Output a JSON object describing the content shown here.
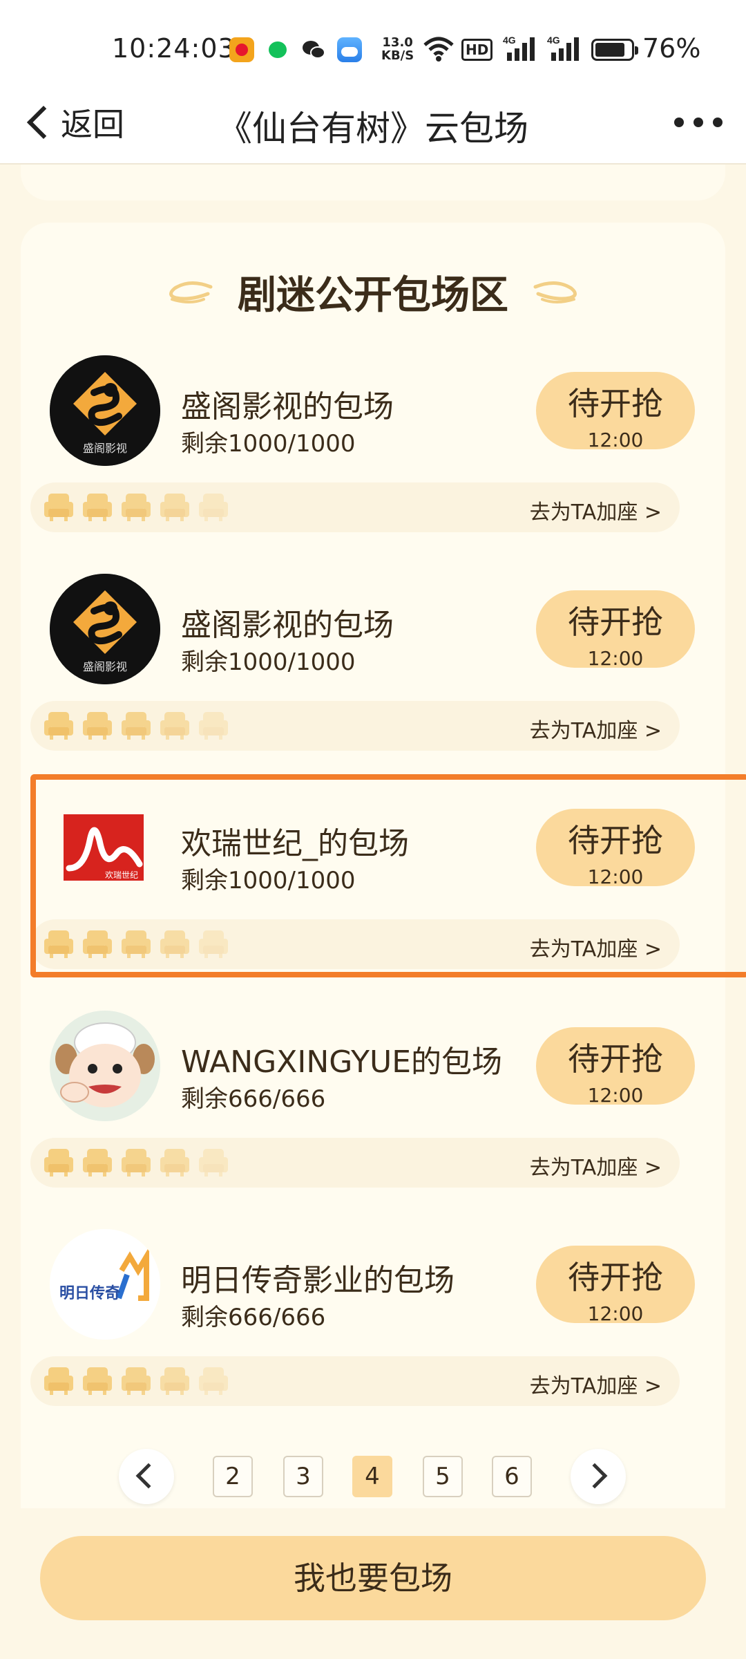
{
  "status_bar": {
    "time": "10:24:03",
    "net_speed_value": "13.0",
    "net_speed_unit": "KB/S",
    "hd_label": "HD",
    "network_1": "4G",
    "network_2": "4G",
    "battery": "76%"
  },
  "nav": {
    "back_label": "返回",
    "title": "《仙台有树》云包场"
  },
  "section": {
    "title": "剧迷公开包场区"
  },
  "items": [
    {
      "name": "盛阁影视的包场",
      "remain": "剩余1000/1000",
      "button": "待开抢",
      "time": "12:00",
      "link": "去为TA加座 >",
      "avatar_text": "盛阁影视"
    },
    {
      "name": "盛阁影视的包场",
      "remain": "剩余1000/1000",
      "button": "待开抢",
      "time": "12:00",
      "link": "去为TA加座 >",
      "avatar_text": "盛阁影视"
    },
    {
      "name": "欢瑞世纪_的包场",
      "remain": "剩余1000/1000",
      "button": "待开抢",
      "time": "12:00",
      "link": "去为TA加座 >",
      "avatar_text": "欢瑞世纪"
    },
    {
      "name": "WANGXINGYUE的包场",
      "remain": "剩余666/666",
      "button": "待开抢",
      "time": "12:00",
      "link": "去为TA加座 >",
      "avatar_text": ""
    },
    {
      "name": "明日传奇影业的包场",
      "remain": "剩余666/666",
      "button": "待开抢",
      "time": "12:00",
      "link": "去为TA加座 >",
      "avatar_text": "明日传奇"
    }
  ],
  "pagination": {
    "pages": [
      "2",
      "3",
      "4",
      "5",
      "6"
    ],
    "current": "4"
  },
  "cta": {
    "label": "我也要包场"
  },
  "colors": {
    "accent": "#fbd99c",
    "highlight": "#f37d2a",
    "background": "#fdf7e6"
  }
}
